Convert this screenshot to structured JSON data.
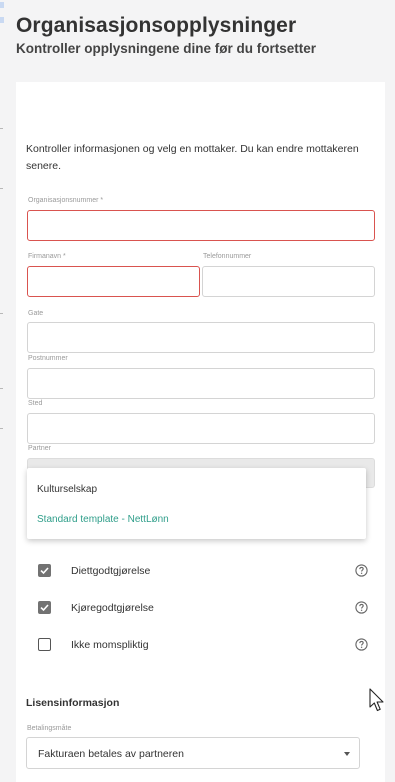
{
  "header": {
    "title": "Organisasjonsopplysninger",
    "subtitle": "Kontroller opplysningene dine før du fortsetter"
  },
  "form": {
    "intro": "Kontroller informasjonen og velg en mottaker. Du kan endre mottakeren senere.",
    "fields": {
      "org_number": {
        "label": "Organisasjonsnummer *",
        "value": ""
      },
      "company_name": {
        "label": "Firmanavn *",
        "value": ""
      },
      "phone": {
        "label": "Telefonnummer",
        "value": ""
      },
      "street": {
        "label": "Gate",
        "value": ""
      },
      "postal_code": {
        "label": "Postnummer",
        "value": ""
      },
      "city": {
        "label": "Sted",
        "value": ""
      },
      "partner": {
        "label": "Partner",
        "value": ""
      }
    },
    "partner_options": [
      "Kulturselskap",
      "Standard template - NettLønn"
    ],
    "checkboxes": [
      {
        "label": "Diettgodtgjørelse",
        "checked": true,
        "icon": "help-circle-icon"
      },
      {
        "label": "Kjøregodtgjørelse",
        "checked": true,
        "icon": "help-circle-icon"
      },
      {
        "label": "Ikke momspliktig",
        "checked": false,
        "icon": "help-circle-icon"
      }
    ]
  },
  "license": {
    "title": "Lisensinformasjon",
    "payment_label": "Betalingsmåte",
    "payment_value": "Fakturaen betales av partneren"
  },
  "colors": {
    "error_border": "#d9534f",
    "option_accent": "#2f9e8a",
    "checkbox_checked": "#727272",
    "page_background": "#f4f4f5"
  }
}
